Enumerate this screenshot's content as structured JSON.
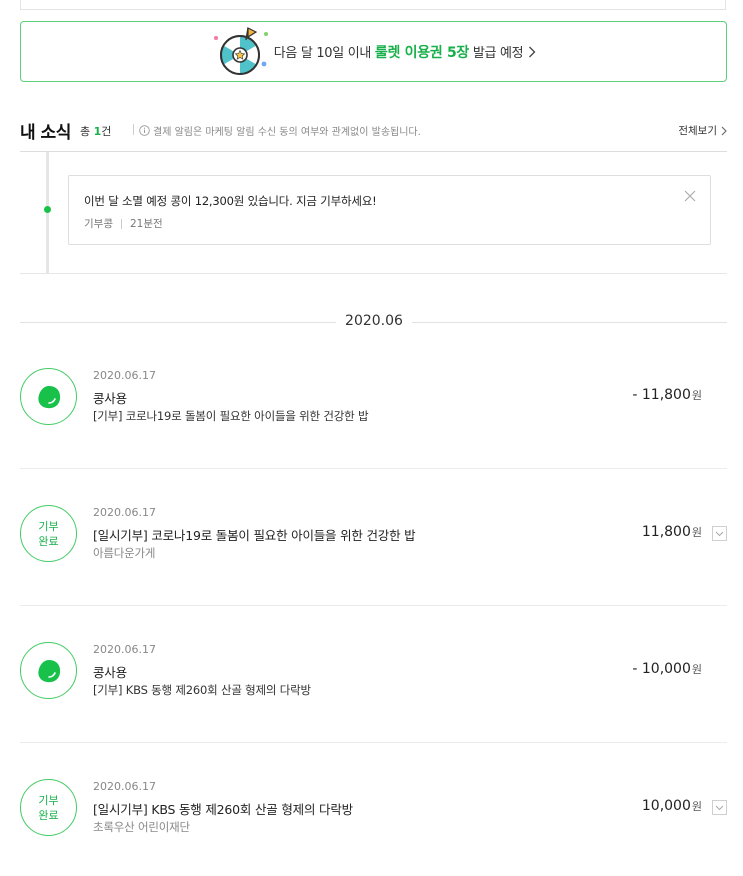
{
  "banner": {
    "text_before": "다음 달 10일 이내 ",
    "highlight": "룰렛 이용권 5장",
    "text_after": " 발급 예정",
    "accent_color": "#18b04a",
    "icon": "roulette-icon"
  },
  "news": {
    "title": "내 소식",
    "count_prefix": "총 ",
    "count_value": "1",
    "count_suffix": "건",
    "note": "결제 알림은 마케팅 알림 수신 동의 여부와 관계없이 발송됩니다.",
    "view_all": "전체보기"
  },
  "notice": {
    "text": "이번 달 소멸 예정 콩이 12,300원 있습니다. 지금 기부하세요!",
    "source": "기부콩",
    "time": "21분전"
  },
  "month": "2020.06",
  "transactions": [
    {
      "date": "2020.06.17",
      "title": "콩사용",
      "desc": "[기부] 코로나19로 돌봄이 필요한 아이들을 위한 건강한 밥",
      "amount": "- 11,800",
      "unit": "원",
      "icon": "bean-icon"
    },
    {
      "date": "2020.06.17",
      "badge_line1": "기부",
      "badge_line2": "완료",
      "title": "[일시기부] 코로나19로 돌봄이 필요한 아이들을 위한 건강한 밥",
      "desc": "아름다운가게",
      "amount": "11,800",
      "unit": "원"
    },
    {
      "date": "2020.06.17",
      "title": "콩사용",
      "desc": "[기부] KBS 동행 제260회 산골 형제의 다락방",
      "amount": "- 10,000",
      "unit": "원",
      "icon": "bean-icon"
    },
    {
      "date": "2020.06.17",
      "badge_line1": "기부",
      "badge_line2": "완료",
      "title": "[일시기부] KBS 동행 제260회 산골 형제의 다락방",
      "desc": "초록우산 어린이재단",
      "amount": "10,000",
      "unit": "원"
    }
  ]
}
